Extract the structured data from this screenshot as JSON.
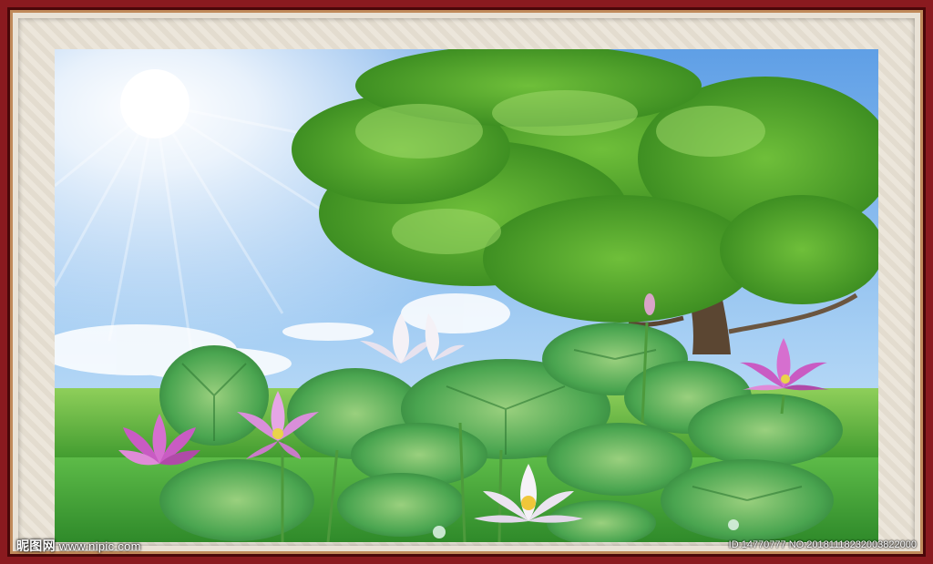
{
  "watermark": {
    "brand": "昵图网",
    "site": "www.nipic.com",
    "id_text": "ID:14770777 NO:20181118232003822000"
  },
  "colors": {
    "frame": "#8a1a1f",
    "sky": "#7fb8ec",
    "leaf": "#3f9a45",
    "lotus_pink": "#d66fcf",
    "lotus_white": "#f4f1f6"
  },
  "icons": [
    "tree-icon",
    "sun-icon",
    "lotus-flower-icon",
    "lotus-leaf-icon"
  ]
}
